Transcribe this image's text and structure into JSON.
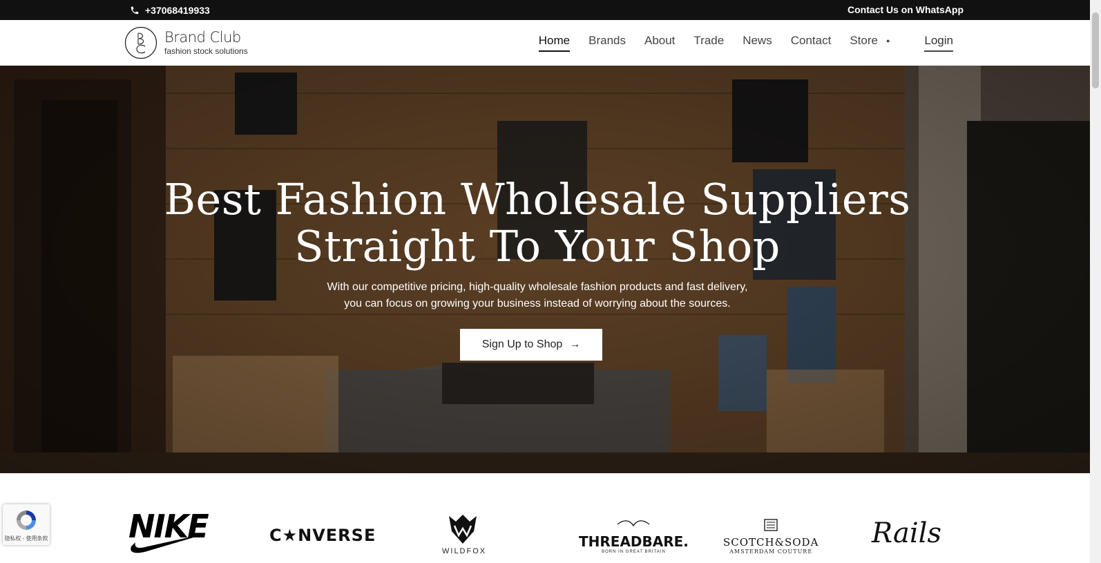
{
  "topbar": {
    "phone": "+37068419933",
    "whatsapp": "Contact Us on WhatsApp"
  },
  "header": {
    "logo_name": "Brand Club",
    "logo_tagline": "fashion stock solutions",
    "nav": {
      "home": "Home",
      "brands": "Brands",
      "about": "About",
      "trade": "Trade",
      "news": "News",
      "contact": "Contact",
      "store": "Store",
      "login": "Login"
    }
  },
  "hero": {
    "title_line1": "Best Fashion Wholesale Suppliers",
    "title_line2": "Straight To Your Shop",
    "subtitle_line1": "With our competitive pricing, high-quality wholesale fashion products and fast delivery,",
    "subtitle_line2": "you can focus on growing your business instead of worrying about the sources.",
    "cta_label": "Sign Up to Shop",
    "cta_arrow": "→"
  },
  "brands": {
    "nike": "NIKE",
    "converse": "C★NVERSE",
    "wildfox": "WILDFOX",
    "threadbare": "THREADBARE.",
    "threadbare_sub": "BORN IN GREAT BRITAIN",
    "scotch": "SCOTCH&SODA",
    "scotch_sub": "AMSTERDAM COUTURE",
    "rails": "Rails"
  },
  "recaptcha": {
    "links": "隐私权 - 使用条款"
  },
  "colors": {
    "topbar_bg": "#111111",
    "accent": "#111111",
    "hero_overlay": "#5a3f26"
  }
}
